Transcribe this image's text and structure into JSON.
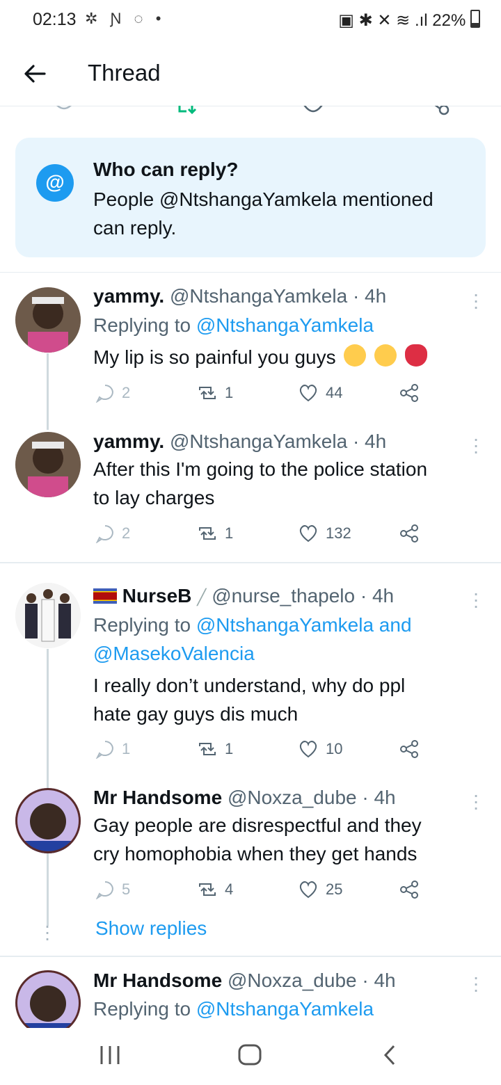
{
  "status_bar": {
    "time": "02:13",
    "battery": "22%"
  },
  "header": {
    "title": "Thread"
  },
  "who_can_reply": {
    "title": "Who can reply?",
    "line1": "People @NtshangaYamkela mentioned",
    "line2": "can reply."
  },
  "tweets": [
    {
      "name": "yammy.",
      "handle": "@NtshangaYamkela",
      "time": "· 4h",
      "replying_prefix": "Replying to",
      "replying_to": "@NtshangaYamkela",
      "text1": "My lip is so painful you guys",
      "replies": "2",
      "retweets": "1",
      "likes": "44"
    },
    {
      "name": "yammy.",
      "handle": "@NtshangaYamkela",
      "time": "· 4h",
      "text1": "After this I'm going to the police station",
      "text2": "to lay charges",
      "replies": "2",
      "retweets": "1",
      "likes": "132"
    },
    {
      "name": "NurseB",
      "handle": "@nurse_thapelo",
      "time": "· 4h",
      "replying_prefix": "Replying to",
      "replying_to": "@NtshangaYamkela and",
      "replying_to2": "@MasekoValencia",
      "text1": "I really don’t understand, why do ppl",
      "text2": "hate gay guys dis much",
      "replies": "1",
      "retweets": "1",
      "likes": "10"
    },
    {
      "name": "Mr Handsome",
      "handle": "@Noxza_dube",
      "time": "· 4h",
      "text1": "Gay people are disrespectful and they",
      "text2": "cry homophobia when they get hands",
      "replies": "5",
      "retweets": "4",
      "likes": "25"
    },
    {
      "name": "Mr Handsome",
      "handle": "@Noxza_dube",
      "time": "· 4h",
      "replying_prefix": "Replying to",
      "replying_to": "@NtshangaYamkela"
    }
  ],
  "show_replies": "Show replies",
  "colors": {
    "accent": "#1d9bf0",
    "muted": "#536471",
    "info_bg": "#e8f5fd"
  }
}
